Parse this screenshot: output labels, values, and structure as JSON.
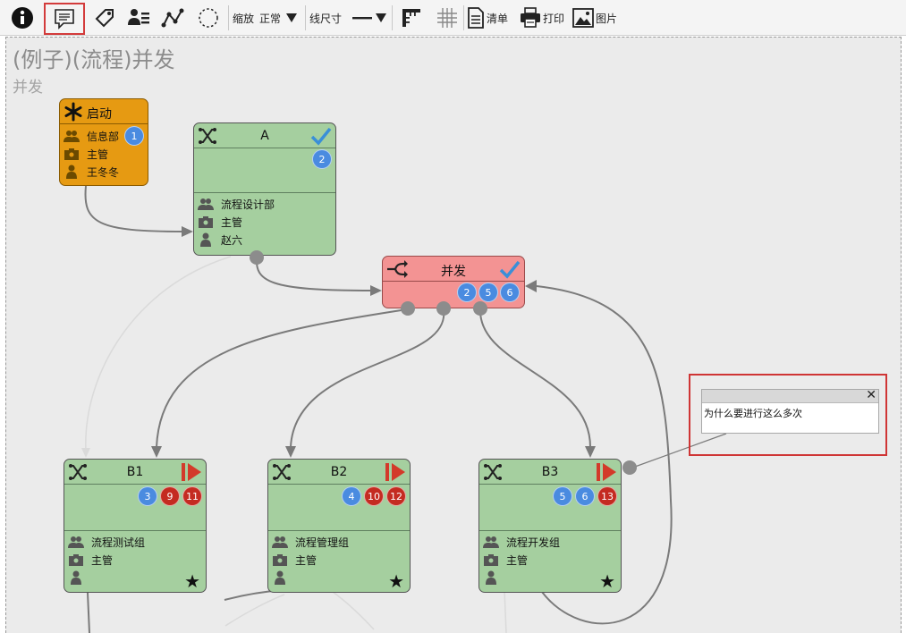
{
  "toolbar": {
    "zoom_label": "缩放",
    "zoom_value": "正常",
    "line_label": "线尺寸",
    "list_label": "清单",
    "print_label": "打印",
    "image_label": "图片",
    "highlight_color": "#d33b3b"
  },
  "flow": {
    "title": "(例子)(流程)并发",
    "subtitle": "并发"
  },
  "nodes": {
    "start": {
      "title": "启动",
      "rows": [
        "信息部",
        "主管",
        "王冬冬"
      ],
      "badges": [
        "1"
      ],
      "color": "#e69a12"
    },
    "a": {
      "title": "A",
      "rows": [
        "流程设计部",
        "主管",
        "赵六"
      ],
      "badges": [
        "2"
      ],
      "color": "#a5cf9f"
    },
    "gate": {
      "title": "并发",
      "badges": [
        "2",
        "5",
        "6"
      ],
      "color": "#f39393"
    },
    "b1": {
      "title": "B1",
      "rows": [
        "流程测试组",
        "主管",
        ""
      ],
      "badges": [
        "3",
        "9",
        "11"
      ]
    },
    "b2": {
      "title": "B2",
      "rows": [
        "流程管理组",
        "主管",
        ""
      ],
      "badges": [
        "4",
        "10",
        "12"
      ]
    },
    "b3": {
      "title": "B3",
      "rows": [
        "流程开发组",
        "主管",
        ""
      ],
      "badges": [
        "5",
        "6",
        "13"
      ]
    }
  },
  "comment": {
    "text": "为什么要进行这么多次",
    "close": "✕"
  },
  "colors": {
    "canvas": "#ebebeb",
    "badge_blue": "#4a8be0",
    "badge_red": "#c42b21",
    "check": "#3a8fd8",
    "play": "#d33a2a"
  }
}
